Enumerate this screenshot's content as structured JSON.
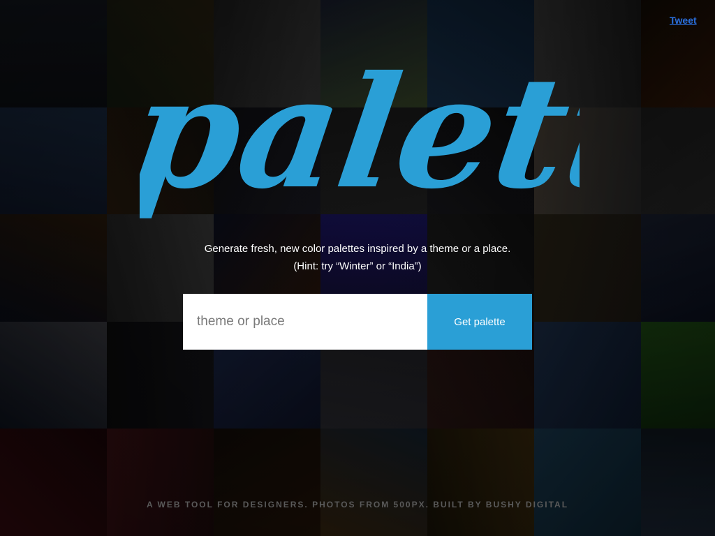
{
  "colors": {
    "accent": "#2a9fd6",
    "footer_text": "#5a5a5a",
    "tweet_link": "#2a6fdd"
  },
  "logo": {
    "text": "palettr"
  },
  "tagline": {
    "line1": "Generate fresh, new color palettes inspired by a theme or a place.",
    "line2": "(Hint: try “Winter” or “India”)"
  },
  "search": {
    "placeholder": "theme or place",
    "value": "",
    "button_label": "Get palette"
  },
  "tweet": {
    "label": "Tweet"
  },
  "footer": {
    "text": "A WEB TOOL FOR DESIGNERS. PHOTOS FROM 500PX. BUILT BY BUSHY DIGITAL"
  },
  "background_tiles": [
    {
      "colors": [
        "#0d0f14",
        "#14181f"
      ]
    },
    {
      "colors": [
        "#141c10",
        "#2a2212"
      ]
    },
    {
      "colors": [
        "#1e1e1e",
        "#3a3a3a"
      ]
    },
    {
      "colors": [
        "#1a2030",
        "#3a4a2a"
      ]
    },
    {
      "colors": [
        "#0e2238",
        "#18324e"
      ]
    },
    {
      "colors": [
        "#1c1c1c",
        "#3a3a3a"
      ]
    },
    {
      "colors": [
        "#3a1a08",
        "#140c06"
      ]
    },
    {
      "colors": [
        "#10182a",
        "#1a2a40"
      ]
    },
    {
      "colors": [
        "#2a1c0e",
        "#14110d"
      ]
    },
    {
      "colors": [
        "#0e0e12",
        "#1a1a22"
      ]
    },
    {
      "colors": [
        "#1a1a1a",
        "#242424"
      ]
    },
    {
      "colors": [
        "#0c0c0e",
        "#18181c"
      ]
    },
    {
      "colors": [
        "#2a2a2a",
        "#4a4238"
      ]
    },
    {
      "colors": [
        "#2a2a2a",
        "#1e1e1e"
      ]
    },
    {
      "colors": [
        "#0a0e1a",
        "#2a1a0a"
      ]
    },
    {
      "colors": [
        "#1e1e1e",
        "#3a3a3a"
      ]
    },
    {
      "colors": [
        "#0c1020",
        "#2a1608"
      ]
    },
    {
      "colors": [
        "#1a1460",
        "#120e30"
      ]
    },
    {
      "colors": [
        "#101010",
        "#1e1e1e"
      ]
    },
    {
      "colors": [
        "#1e1a14",
        "#2a2418"
      ]
    },
    {
      "colors": [
        "#0a1020",
        "#1a2030"
      ]
    },
    {
      "colors": [
        "#0e1420",
        "#3a3a40"
      ]
    },
    {
      "colors": [
        "#0a0a0c",
        "#141418"
      ]
    },
    {
      "colors": [
        "#1a2444",
        "#0e1428"
      ]
    },
    {
      "colors": [
        "#1e1e22",
        "#2a2a30"
      ]
    },
    {
      "colors": [
        "#1a0e0c",
        "#2a1614"
      ]
    },
    {
      "colors": [
        "#0e1a2e",
        "#1c2e48"
      ]
    },
    {
      "colors": [
        "#0e2a0c",
        "#1e4a14"
      ]
    },
    {
      "colors": [
        "#3a0c10",
        "#1a0608"
      ]
    },
    {
      "colors": [
        "#3a1014",
        "#1e0a0c"
      ]
    },
    {
      "colors": [
        "#120c08",
        "#241408"
      ]
    },
    {
      "colors": [
        "#14202e",
        "#3a2810"
      ]
    },
    {
      "colors": [
        "#3a2a0c",
        "#1a1408"
      ]
    },
    {
      "colors": [
        "#0e2838",
        "#1a3a50"
      ]
    },
    {
      "colors": [
        "#1e2a3a",
        "#101820"
      ]
    }
  ]
}
